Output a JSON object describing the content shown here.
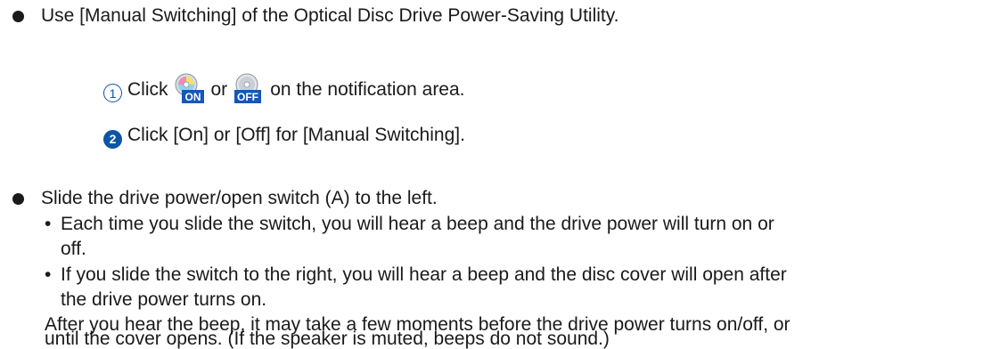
{
  "section1": {
    "bullet_text": "Use [Manual Switching] of the Optical Disc Drive Power-Saving Utility.",
    "step1": {
      "number": "1",
      "prefix": "Click",
      "between": "or",
      "suffix": "on the notification area.",
      "icon_on_label": "ON",
      "icon_off_label": "OFF"
    },
    "step2": {
      "number": "2",
      "text": "Click [On] or [Off] for [Manual Switching]."
    }
  },
  "section2": {
    "bullet_text": "Slide the drive power/open switch (A) to the left.",
    "sub1_line1": "Each time you slide the switch, you will hear a beep and the drive power will turn on or",
    "sub1_line2": "off.",
    "sub2_line1": "If you slide the switch to the right, you will hear a beep and the disc cover will open after",
    "sub2_line2": "the drive power turns on.",
    "note_line1": "After you hear the beep, it may take a few moments before the drive power turns on/off, or",
    "note_line2": "until the cover opens. (If the speaker is muted, beeps do not sound.)"
  },
  "colors": {
    "accent": "#0b55a6",
    "text": "#1a1a1a"
  }
}
